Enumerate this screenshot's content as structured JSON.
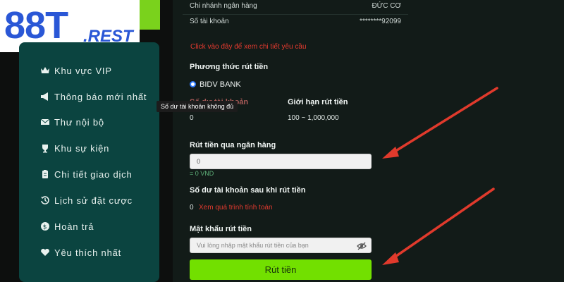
{
  "logo": {
    "brand": "88T",
    "tld": ".REST"
  },
  "sidebar": {
    "items": [
      {
        "label": "Khu vực VIP",
        "icon": "crown-icon"
      },
      {
        "label": "Thông báo mới nhất",
        "icon": "megaphone-icon"
      },
      {
        "label": "Thư nội bộ",
        "icon": "envelope-icon"
      },
      {
        "label": "Khu sự kiện",
        "icon": "trophy-icon"
      },
      {
        "label": "Chi tiết giao dịch",
        "icon": "clipboard-icon"
      },
      {
        "label": "Lịch sử đặt cược",
        "icon": "history-icon"
      },
      {
        "label": "Hoàn trả",
        "icon": "dollar-icon"
      },
      {
        "label": "Yêu thích nhất",
        "icon": "heart-icon"
      }
    ]
  },
  "tooltip": "Số dư tài khoản không đủ",
  "account": {
    "branch_label": "Chi nhánh ngân hàng",
    "branch_value": "ĐỨC CƠ",
    "number_label": "Số tài khoản",
    "number_value": "********92099"
  },
  "detail_link": "Click vào đây để xem chi tiết yêu cầu",
  "method": {
    "title": "Phương thức rút tiền",
    "option": "BIDV BANK"
  },
  "limits": {
    "balance_label": "Số dư tài khoản",
    "balance_value": "0",
    "limit_label": "Giới hạn rút tiền",
    "limit_value": "100 ~ 1,000,000"
  },
  "withdraw": {
    "title": "Rút tiền qua ngân hàng",
    "value": "0",
    "hint": "= 0 VND"
  },
  "after": {
    "title": "Số dư tài khoản sau khi rút tiền",
    "value": "0",
    "link": "Xem quá trình tính toán"
  },
  "password": {
    "title": "Mật khẩu rút tiền",
    "placeholder": "Vui lòng nhập mật khẩu rút tiền của bạn"
  },
  "submit_label": "Rút tiền",
  "colors": {
    "accent": "#72e000",
    "sidebar": "#0b4440",
    "arrow": "#e03a2c",
    "link": "#e23a2f"
  }
}
